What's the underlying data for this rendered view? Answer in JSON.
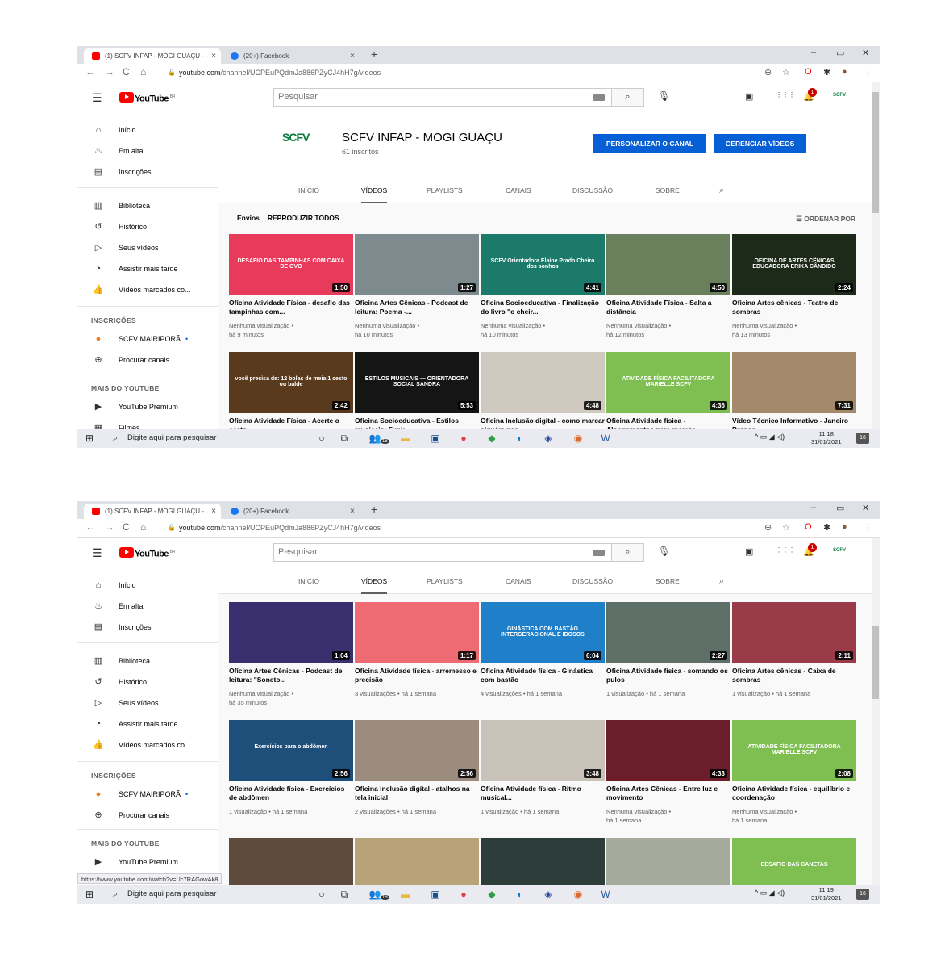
{
  "browser": {
    "tab1_title": "(1) SCFV INFAP - MOGI GUAÇU -",
    "tab1_close": "×",
    "tab2_title": "(20+) Facebook",
    "tab2_close": "×",
    "new_tab": "+",
    "url_domain": "youtube.com",
    "url_path": "/channel/UCPEuPQdmJa886PZyCJ4hH7g/videos",
    "status_url": "https://www.youtube.com/watch?v=Uc7RAGowAk8"
  },
  "youtube": {
    "logo_text": "YouTube",
    "logo_region": "BR",
    "search_placeholder": "Pesquisar",
    "bell_badge": "1",
    "avatar_text": "SCFV"
  },
  "sidebar": {
    "items": [
      {
        "label": "Início",
        "icon": "home-icon"
      },
      {
        "label": "Em alta",
        "icon": "trending-icon"
      },
      {
        "label": "Inscrições",
        "icon": "subscriptions-icon"
      },
      {
        "label": "Biblioteca",
        "icon": "library-icon"
      },
      {
        "label": "Histórico",
        "icon": "history-icon"
      },
      {
        "label": "Seus vídeos",
        "icon": "your-videos-icon"
      },
      {
        "label": "Assistir mais tarde",
        "icon": "watch-later-icon"
      },
      {
        "label": "Vídeos marcados co...",
        "icon": "liked-icon"
      }
    ],
    "subs_header": "INSCRIÇÕES",
    "sub_channel": "SCFV MAIRIPORÃ",
    "browse_channels": "Procurar canais",
    "more_header": "MAIS DO YOUTUBE",
    "premium": "YouTube Premium",
    "films": "Filmes"
  },
  "channel": {
    "logo_text": "SCFV",
    "name": "SCFV INFAP - MOGI GUAÇU",
    "subscribers": "61 inscritos",
    "customize_btn": "PERSONALIZAR O CANAL",
    "manage_btn": "GERENCIAR VÍDEOS",
    "tabs": [
      "INÍCIO",
      "VÍDEOS",
      "PLAYLISTS",
      "CANAIS",
      "DISCUSSÃO",
      "SOBRE"
    ],
    "uploads_label": "Envios",
    "play_all": "REPRODUZIR TODOS",
    "sort": "ORDENAR POR"
  },
  "screen1_videos": [
    {
      "title": "Oficina Atividade Física - desafio das tampinhas com...",
      "meta1": "Nenhuma visualização •",
      "meta2": "há 9 minutos",
      "duration": "1:50",
      "thumb_text": "DESAFIO DAS TAMPINHAS COM CAIXA DE OVO",
      "color": "#e83a5a"
    },
    {
      "title": "Oficina Artes Cênicas - Podcast de leitura: Poema -...",
      "meta1": "Nenhuma visualização •",
      "meta2": "há 10 minutos",
      "duration": "1:27",
      "thumb_text": "",
      "color": "#7d8a8e"
    },
    {
      "title": "Oficina Socioeducativa - Finalização do livro \"o cheir...",
      "meta1": "Nenhuma visualização •",
      "meta2": "há 10 minutos",
      "duration": "4:41",
      "thumb_text": "SCFV Orientadora Elaine Prado Cheiro dos sonhos",
      "color": "#1b7a6a"
    },
    {
      "title": "Oficina Atividade Física - Salta a distância",
      "meta1": "Nenhuma visualização •",
      "meta2": "há 12 minutos",
      "duration": "4:50",
      "thumb_text": "",
      "color": "#6a7f5c"
    },
    {
      "title": "Oficina Artes cênicas - Teatro de sombras",
      "meta1": "Nenhuma visualização •",
      "meta2": "há 13 minutos",
      "duration": "2:24",
      "thumb_text": "OFICINA DE ARTES CÊNICAS EDUCADORA ERIKA CÂNDIDO",
      "color": "#1d2a1a"
    },
    {
      "title": "Oficina Atividade Física - Acerte o cesto",
      "meta1": "",
      "meta2": "",
      "duration": "2:42",
      "thumb_text": "você precisa de: 12 bolas de meia 1 cesto ou balde",
      "color": "#5a3a1c"
    },
    {
      "title": "Oficina Socioeducativa - Estilos musicais: Funk",
      "meta1": "",
      "meta2": "",
      "duration": "5:53",
      "thumb_text": "ESTILOS MUSICAIS — ORIENTADORA SOCIAL SANDRA",
      "color": "#151515"
    },
    {
      "title": "Oficina Inclusão digital - como marcar alguém nas",
      "meta1": "",
      "meta2": "",
      "duration": "4:48",
      "thumb_text": "",
      "color": "#cfc9c0"
    },
    {
      "title": "Oficina Atividade física - Alongamentos para membr",
      "meta1": "",
      "meta2": "",
      "duration": "4:36",
      "thumb_text": "ATIVIDADE FÍSICA FACILITADORA MARIELLE SCFV",
      "color": "#7fbf52"
    },
    {
      "title": "Vídeo Técnico Informativo - Janeiro Branco",
      "meta1": "",
      "meta2": "",
      "duration": "7:31",
      "thumb_text": "",
      "color": "#a5896b"
    }
  ],
  "screen2_videos": [
    {
      "title": "Oficina Artes Cênicas - Podcast de leitura: \"Soneto...",
      "meta1": "Nenhuma visualização •",
      "meta2": "há 35 minutos",
      "duration": "1:04",
      "thumb_text": "",
      "color": "#3a2f6e"
    },
    {
      "title": "Oficina Atividade física - arremesso e precisão",
      "meta1": "3 visualizações • há 1 semana",
      "meta2": "",
      "duration": "1:17",
      "thumb_text": "",
      "color": "#ef6b73"
    },
    {
      "title": "Oficina Atividade física - Ginástica com bastão",
      "meta1": "4 visualizações • há 1 semana",
      "meta2": "",
      "duration": "6:04",
      "thumb_text": "GINÁSTICA COM BASTÃO INTERGERACIONAL E IDOSOS",
      "color": "#1f7fc8"
    },
    {
      "title": "Oficina Atividade física - somando os pulos",
      "meta1": "1 visualização • há 1 semana",
      "meta2": "",
      "duration": "2:27",
      "thumb_text": "",
      "color": "#5d6f66"
    },
    {
      "title": "Oficina Artes cênicas - Caixa de sombras",
      "meta1": "1 visualização • há 1 semana",
      "meta2": "",
      "duration": "2:11",
      "thumb_text": "",
      "color": "#9a3b4a"
    },
    {
      "title": "Oficina Atividade física - Exercícios de abdômen",
      "meta1": "1 visualização • há 1 semana",
      "meta2": "",
      "duration": "2:56",
      "thumb_text": "Exercícios para o abdômen",
      "color": "#1e4f7a"
    },
    {
      "title": "Oficina inclusão digital - atalhos na tela inicial",
      "meta1": "2 visualizações • há 1 semana",
      "meta2": "",
      "duration": "2:56",
      "thumb_text": "",
      "color": "#9c8c7e"
    },
    {
      "title": "Oficina Atividade física - Ritmo musical...",
      "meta1": "1 visualização • há 1 semana",
      "meta2": "",
      "duration": "3:48",
      "thumb_text": "",
      "color": "#c9c2b8"
    },
    {
      "title": "Oficina Artes Cênicas - Entre luz e movimento",
      "meta1": "Nenhuma visualização •",
      "meta2": "há 1 semana",
      "duration": "4:33",
      "thumb_text": "",
      "color": "#6b1e2a"
    },
    {
      "title": "Oficina Atividade física - equilíbrio e coordenação",
      "meta1": "Nenhuma visualização •",
      "meta2": "há 1 semana",
      "duration": "2:08",
      "thumb_text": "ATIVIDADE FÍSICA FACILITADORA MARIELLE SCFV",
      "color": "#7fbf52"
    },
    {
      "title": "",
      "meta1": "",
      "meta2": "",
      "duration": "",
      "thumb_text": "",
      "color": "#5e4b3e"
    },
    {
      "title": "",
      "meta1": "",
      "meta2": "",
      "duration": "",
      "thumb_text": "",
      "color": "#b7a27a"
    },
    {
      "title": "",
      "meta1": "",
      "meta2": "",
      "duration": "",
      "thumb_text": "",
      "color": "#2c3d3a"
    },
    {
      "title": "",
      "meta1": "",
      "meta2": "",
      "duration": "",
      "thumb_text": "",
      "color": "#a4aa9c"
    },
    {
      "title": "",
      "meta1": "",
      "meta2": "",
      "duration": "",
      "thumb_text": "DESAFIO DAS CANETAS",
      "color": "#7fbf52"
    }
  ],
  "taskbar": {
    "search_placeholder": "Digite aqui para pesquisar",
    "badge": "15",
    "notif_count": "16",
    "time1": "11:18",
    "time2": "11:19",
    "date": "31/01/2021"
  }
}
